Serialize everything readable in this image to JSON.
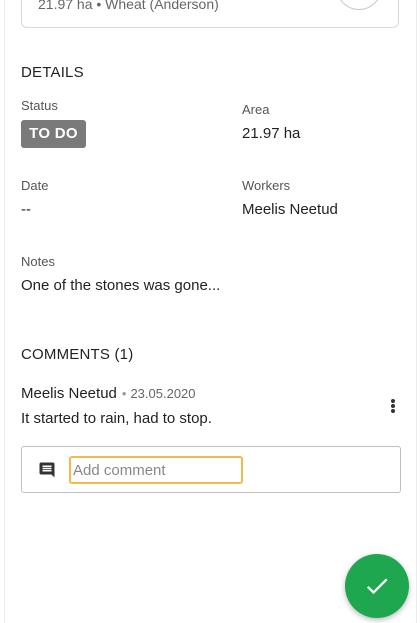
{
  "top_card": {
    "subtitle": "21.97 ha • Wheat (Anderson)"
  },
  "details": {
    "title": "DETAILS",
    "status_label": "Status",
    "status_value": "TO DO",
    "area_label": "Area",
    "area_value": "21.97 ha",
    "date_label": "Date",
    "date_value": "--",
    "workers_label": "Workers",
    "workers_value": "Meelis Neetud",
    "notes_label": "Notes",
    "notes_value": "One of the stones was gone..."
  },
  "comments": {
    "title": "COMMENTS (1)",
    "items": [
      {
        "author": "Meelis Neetud",
        "separator": "•",
        "date": "23.05.2020",
        "text": "It started to rain, had to stop."
      }
    ],
    "input_placeholder": "Add comment"
  },
  "colors": {
    "accent_green": "#1ea74f",
    "status_badge": "#7a7a7a",
    "input_focus": "#f5b84a"
  },
  "icons": {
    "top_card_action": "circle-button",
    "comment_menu": "more-vertical-icon",
    "comment_field": "comment-icon",
    "fab": "check-icon"
  }
}
